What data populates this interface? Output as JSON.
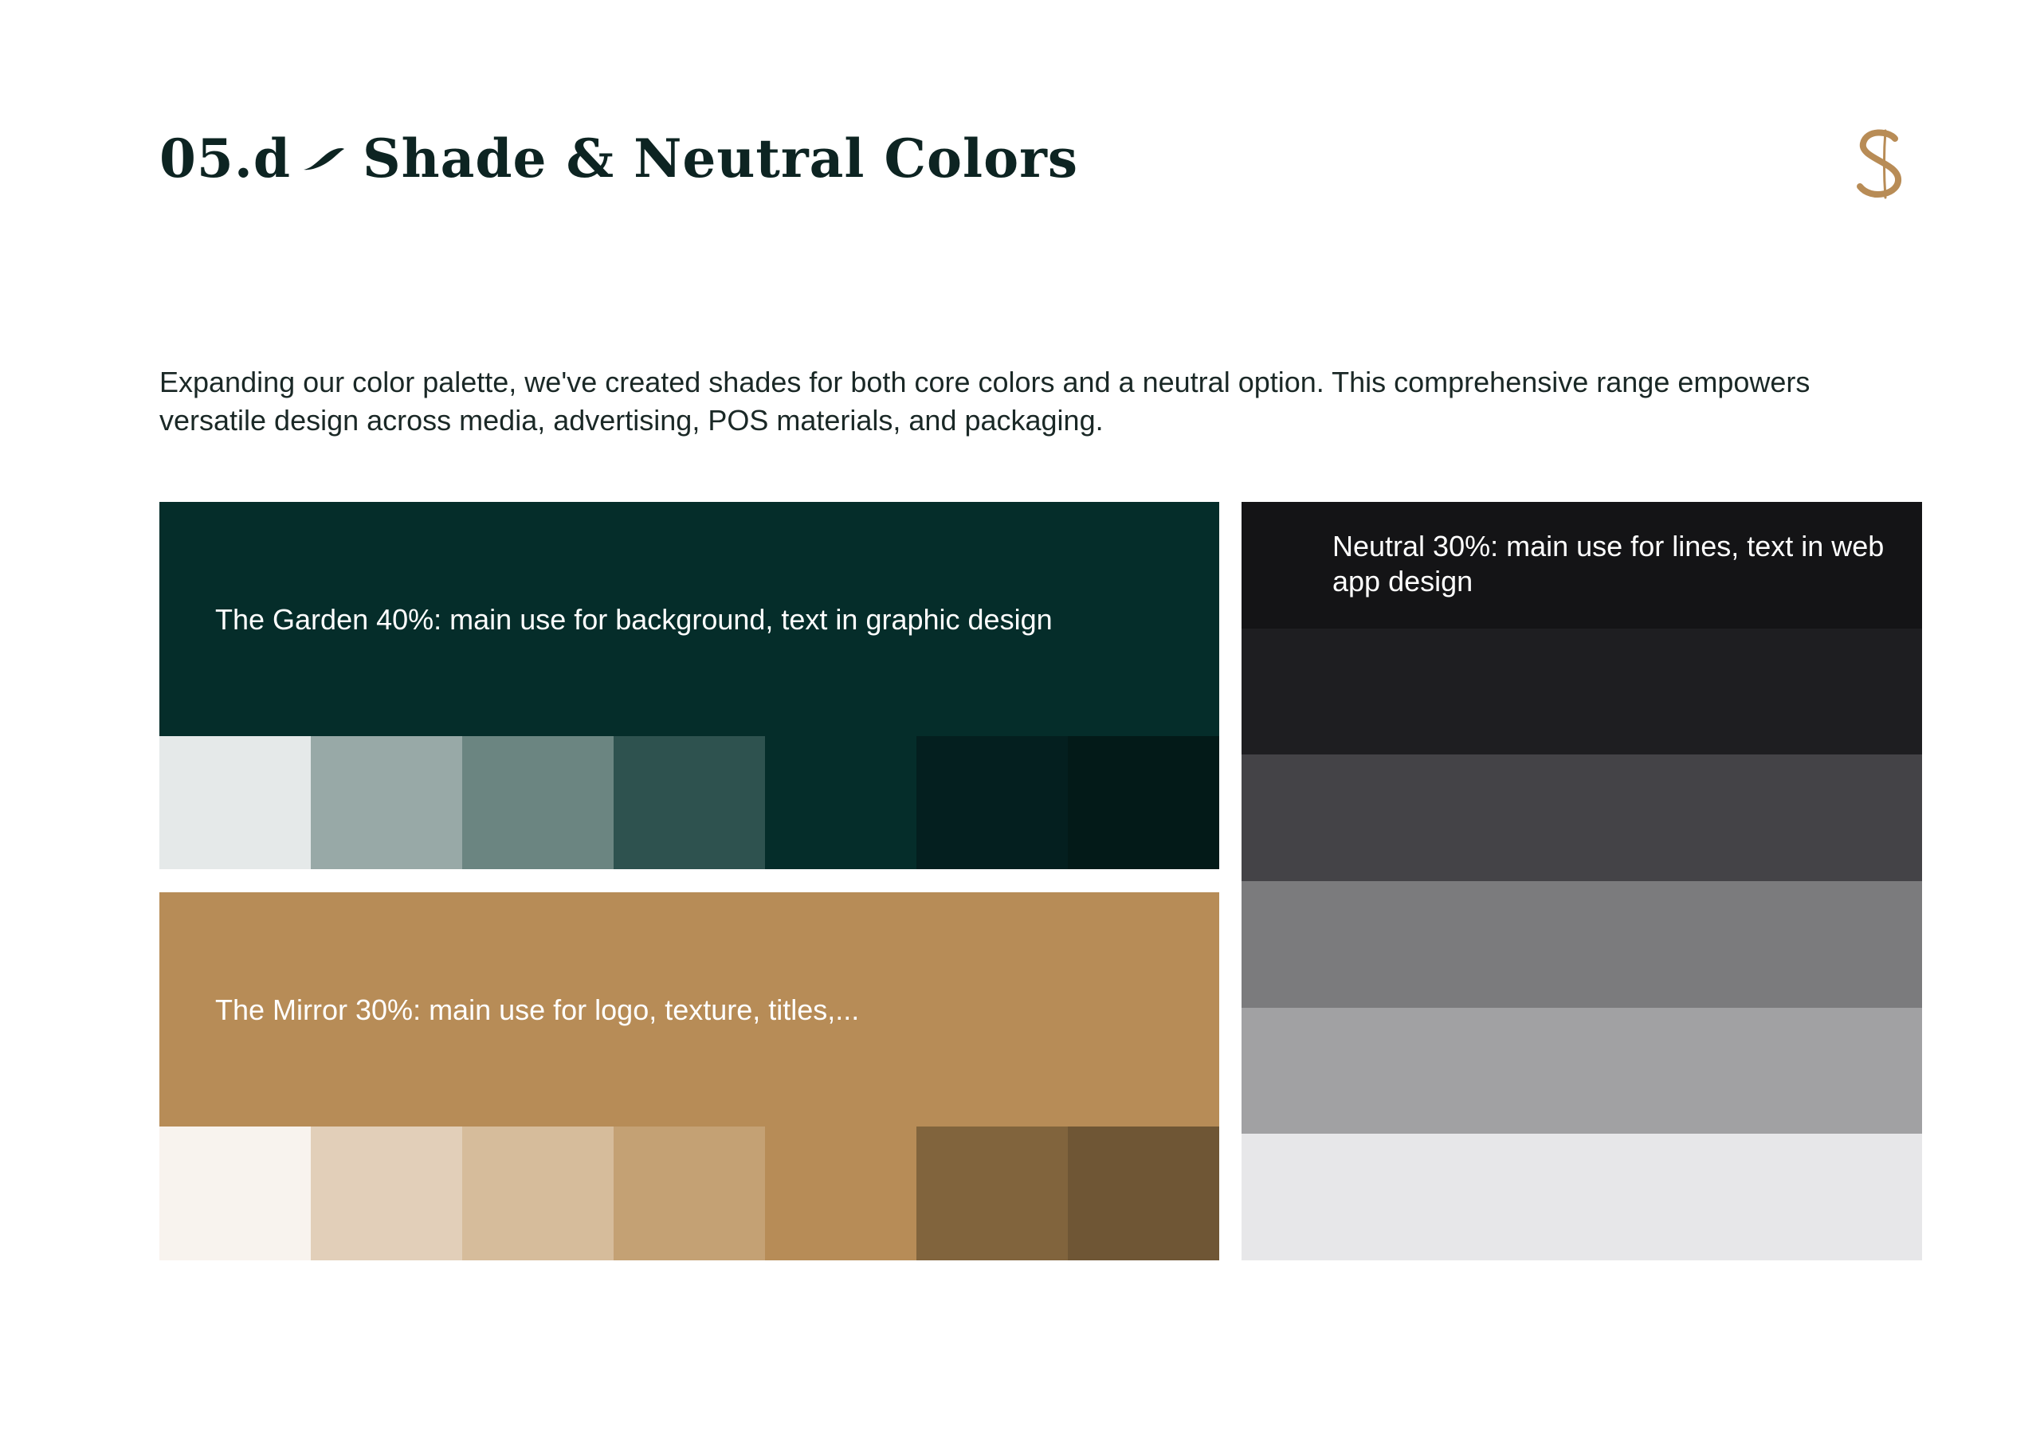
{
  "header": {
    "section_number": "05.d",
    "title": "Shade & Neutral Colors",
    "logo_icon": "S-monogram-icon",
    "logo_color": "#b88c56",
    "title_color": "#0d2422"
  },
  "intro": {
    "text": "Expanding our color palette, we've created shades for both core colors and a neutral option. This comprehensive range empowers versatile design across media, advertising, POS materials, and packaging."
  },
  "palettes": {
    "garden": {
      "label": "The Garden 40%: main use for background, text in graphic design",
      "base_color": "#052d2a",
      "shades": [
        "#e5e9e9",
        "#98a9a7",
        "#6b8581",
        "#2e524f",
        "#052d2a",
        "#041f1f",
        "#031a18"
      ]
    },
    "mirror": {
      "label": "The Mirror 30%: main use for logo, texture, titles,...",
      "base_color": "#b78c57",
      "shades": [
        "#f8f3ee",
        "#e2cfb9",
        "#d6bc9b",
        "#c4a174",
        "#b78c57",
        "#81643d",
        "#6f5635"
      ]
    },
    "neutral": {
      "label": "Neutral 30%: main use for lines, text in web app design",
      "shades": [
        "#141416",
        "#1e1e21",
        "#444347",
        "#7b7b7d",
        "#a1a1a3",
        "#e7e7e9"
      ]
    }
  }
}
